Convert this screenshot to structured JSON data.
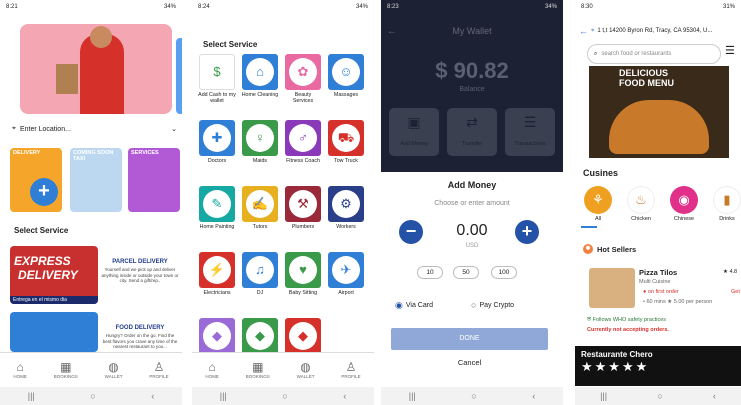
{
  "phone1": {
    "status_time": "8:21",
    "status_right": "34%",
    "location_placeholder": "Enter Location...",
    "card_delivery": "DELIVERY",
    "card_taxi": "COMING SOON TAXI",
    "card_services": "SERVICES",
    "select_service": "Select Service",
    "parcel_title": "PARCEL DELIVERY",
    "parcel_desc": "Yourself and we pick up and deliver anything inside or outside your town or city. Send a gift/rep..",
    "express_line1": "EXPRESS",
    "express_line2": "DELIVERY",
    "express_caption": "Entrega en el mismo dia",
    "food_title": "FOOD DELIVERY",
    "food_desc": "Hungry? Order on the go. Find the best flavors you crave any time of the nearest restaurant to you..."
  },
  "phone2": {
    "status_time": "8:24",
    "status_right": "34%",
    "select_service": "Select Service",
    "services": [
      {
        "label": "Add Cash to my wallet",
        "icon": "wallet-icon",
        "color": "#ffffff"
      },
      {
        "label": "Home Cleaning",
        "icon": "home-icon",
        "color": "#2f7fd6"
      },
      {
        "label": "Beauty Services",
        "icon": "beauty-icon",
        "color": "#e86aa0"
      },
      {
        "label": "Massages",
        "icon": "massage-icon",
        "color": "#2f7fd6"
      },
      {
        "label": "Doctors",
        "icon": "doctor-icon",
        "color": "#2f7fd6"
      },
      {
        "label": "Maids",
        "icon": "maid-icon",
        "color": "#3a9a4a"
      },
      {
        "label": "Fitness Coach",
        "icon": "fitness-icon",
        "color": "#8a3ab8"
      },
      {
        "label": "Tow Truck",
        "icon": "tow-truck-icon",
        "color": "#d6302a"
      },
      {
        "label": "Home Painting",
        "icon": "paint-icon",
        "color": "#16a9a4"
      },
      {
        "label": "Tutors",
        "icon": "tutor-icon",
        "color": "#e6b020"
      },
      {
        "label": "Plumbers",
        "icon": "plumber-icon",
        "color": "#9a2a3a"
      },
      {
        "label": "Workers",
        "icon": "worker-icon",
        "color": "#2a3f8a"
      },
      {
        "label": "Electricians",
        "icon": "electric-icon",
        "color": "#d6302a"
      },
      {
        "label": "DJ",
        "icon": "dj-icon",
        "color": "#2f7fd6"
      },
      {
        "label": "Baby Sitting",
        "icon": "stroller-icon",
        "color": "#3a9a4a"
      },
      {
        "label": "Airport",
        "icon": "airplane-icon",
        "color": "#2f7fd6"
      },
      {
        "label": "",
        "icon": "misc-icon",
        "color": "#9a6ad6"
      },
      {
        "label": "",
        "icon": "misc-icon",
        "color": "#3a9a4a"
      },
      {
        "label": "",
        "icon": "misc-icon",
        "color": "#d6302a"
      }
    ]
  },
  "nav": {
    "home": "HOME",
    "bookings": "BOOKINGS",
    "wallet": "WALLET",
    "profile": "PROFILE"
  },
  "phone3": {
    "status_time": "8:23",
    "status_right": "34%",
    "title": "My Wallet",
    "balance": "$ 90.82",
    "balance_label": "Balance",
    "actions": [
      "Add Money",
      "Transfer",
      "Transactions"
    ],
    "sheet_title": "Add Money",
    "sheet_subtitle": "Choose or enter amount",
    "amount": "0.00",
    "currency": "USD",
    "quick_amounts": [
      "10",
      "50",
      "100"
    ],
    "pay_card": "Via Card",
    "pay_crypto": "Pay Crypto",
    "done": "DONE",
    "cancel": "Cancel"
  },
  "phone4": {
    "status_time": "8:30",
    "status_right": "31%",
    "address": "1 t,t 14200 Byron Rd, Tracy, CA 95304, U...",
    "search_placeholder": "search food or restaurants",
    "banner_text": "DELICIOUS FOOD MENU",
    "cuisines_title": "Cusines",
    "cuisines": [
      {
        "label": "All",
        "color": "#f0a020"
      },
      {
        "label": "Chicken",
        "color": "#ffffff"
      },
      {
        "label": "Chinese",
        "color": "#e0308a"
      },
      {
        "label": "Drinks",
        "color": "#ffffff"
      }
    ],
    "hot_sellers": "Hot Sellers",
    "restaurant": {
      "name": "Pizza Tilos",
      "rating": "4.8",
      "category": "Multi Cuisine",
      "offer": "on first order",
      "offer_suffix": "Get",
      "time": "60 mins",
      "price": "5.00 per person",
      "safety": "Follows WHO safety practices",
      "closed": "Currently not accepting orders."
    },
    "restaurant2": "Restaurante Chero",
    "stars": "★★★★★"
  }
}
